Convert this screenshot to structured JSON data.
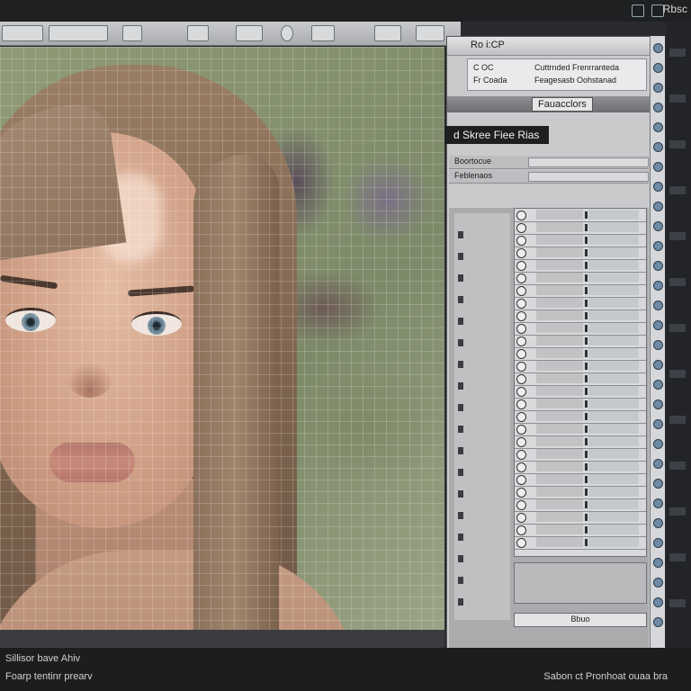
{
  "app": {
    "top_label": "Rbsc"
  },
  "toolbar": {
    "icons": [
      "zoom-icon",
      "pen-tool-icon",
      "grid-icon",
      "move-icon",
      "brush-icon",
      "ellipse-icon",
      "grid-toggle-icon",
      "frame-icon",
      "hand-icon"
    ]
  },
  "panel": {
    "title": "Ro i:CP",
    "info_rows": [
      {
        "label": "C  OC",
        "value": "Cuttrnded  Frenrranteda"
      },
      {
        "label": "Fr   Coada",
        "value": "Feagesasb  Oohstanad"
      }
    ],
    "sub_button": "Fauacclors",
    "header_strip": "d  Skree  Fiee  Rias",
    "rows": [
      {
        "label": "Boortocue"
      },
      {
        "label": "Feblenaos"
      }
    ],
    "footer_value": "Bbuo"
  },
  "status": {
    "line1": "Sillisor  bave  Ahiv",
    "line2": "Foarp  tentinr  prearv",
    "right": "Sabon  ct  Pronhoat  ouaa  bra"
  }
}
